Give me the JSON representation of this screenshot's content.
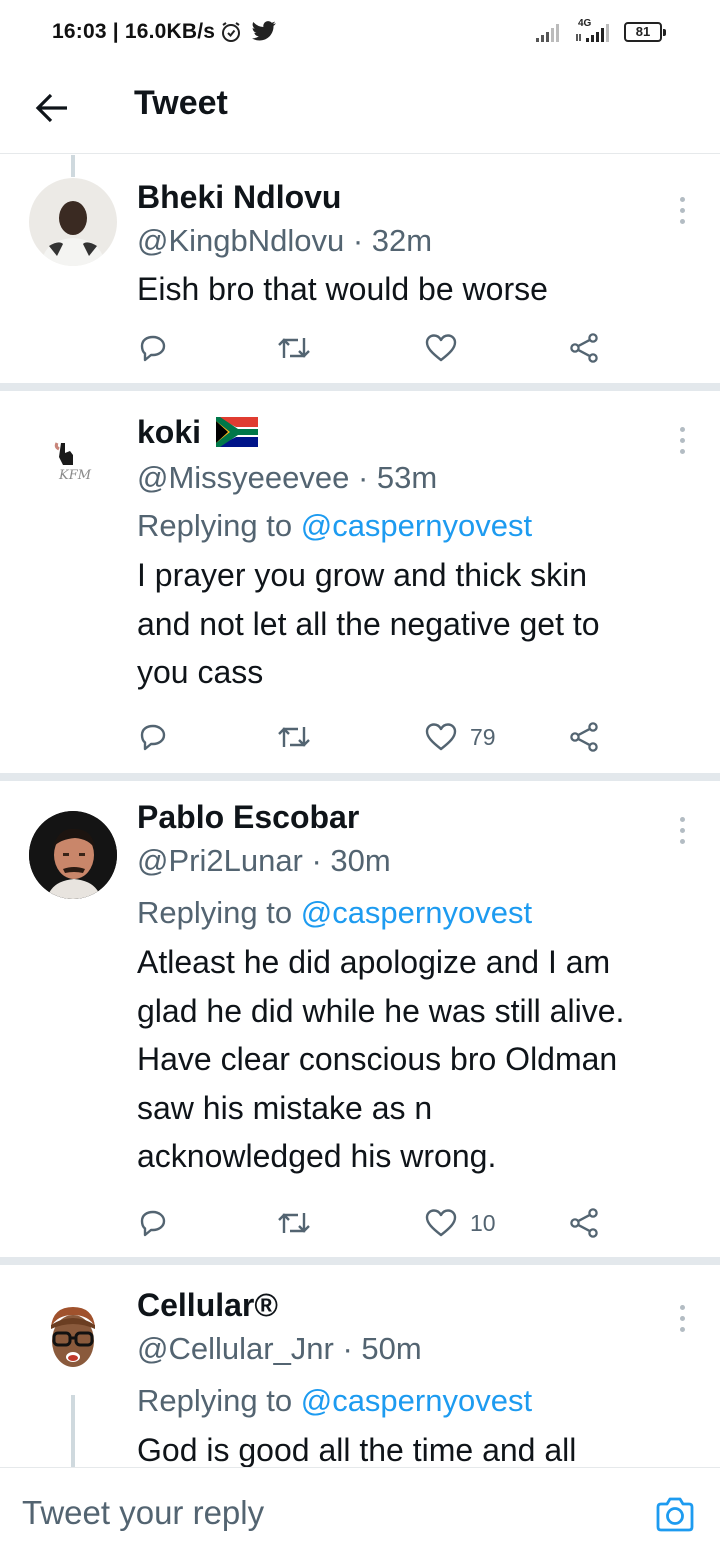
{
  "status_bar": {
    "time": "16:03 | 16.0KB/s",
    "network_label": "4G",
    "battery": "81"
  },
  "header": {
    "title": "Tweet"
  },
  "tweets": [
    {
      "name": "Bheki Ndlovu",
      "handle_time": "@KingbNdlovu · 32m",
      "replying_prefix": "",
      "replying_to": "",
      "lines": [
        "Eish bro that would be worse"
      ],
      "likes": ""
    },
    {
      "name": "koki",
      "flag_icon": "south-africa-flag",
      "handle_time": "@Missyeeevee · 53m",
      "replying_prefix": "Replying to",
      "replying_to": "@caspernyovest",
      "lines": [
        "I prayer you grow and thick skin",
        "and not let all the negative get to",
        "you cass"
      ],
      "likes": "79"
    },
    {
      "name": "Pablo Escobar",
      "handle_time": "@Pri2Lunar · 30m",
      "replying_prefix": "Replying to",
      "replying_to": "@caspernyovest",
      "lines": [
        "Atleast he did apologize and I am",
        "glad he did while he was still alive.",
        "Have clear conscious bro Oldman",
        "saw his mistake as n",
        "acknowledged his wrong."
      ],
      "likes": "10"
    },
    {
      "name": "Cellular®",
      "handle_time": "@Cellular_Jnr · 50m",
      "replying_prefix": "Replying to",
      "replying_to": "@caspernyovest",
      "lines": [
        "God is good all the time and all"
      ],
      "likes": ""
    }
  ],
  "composer": {
    "placeholder": "Tweet your reply"
  },
  "colors": {
    "accent": "#1d9bf0",
    "secondary_text": "#536471",
    "divider": "#e3e8ec"
  }
}
